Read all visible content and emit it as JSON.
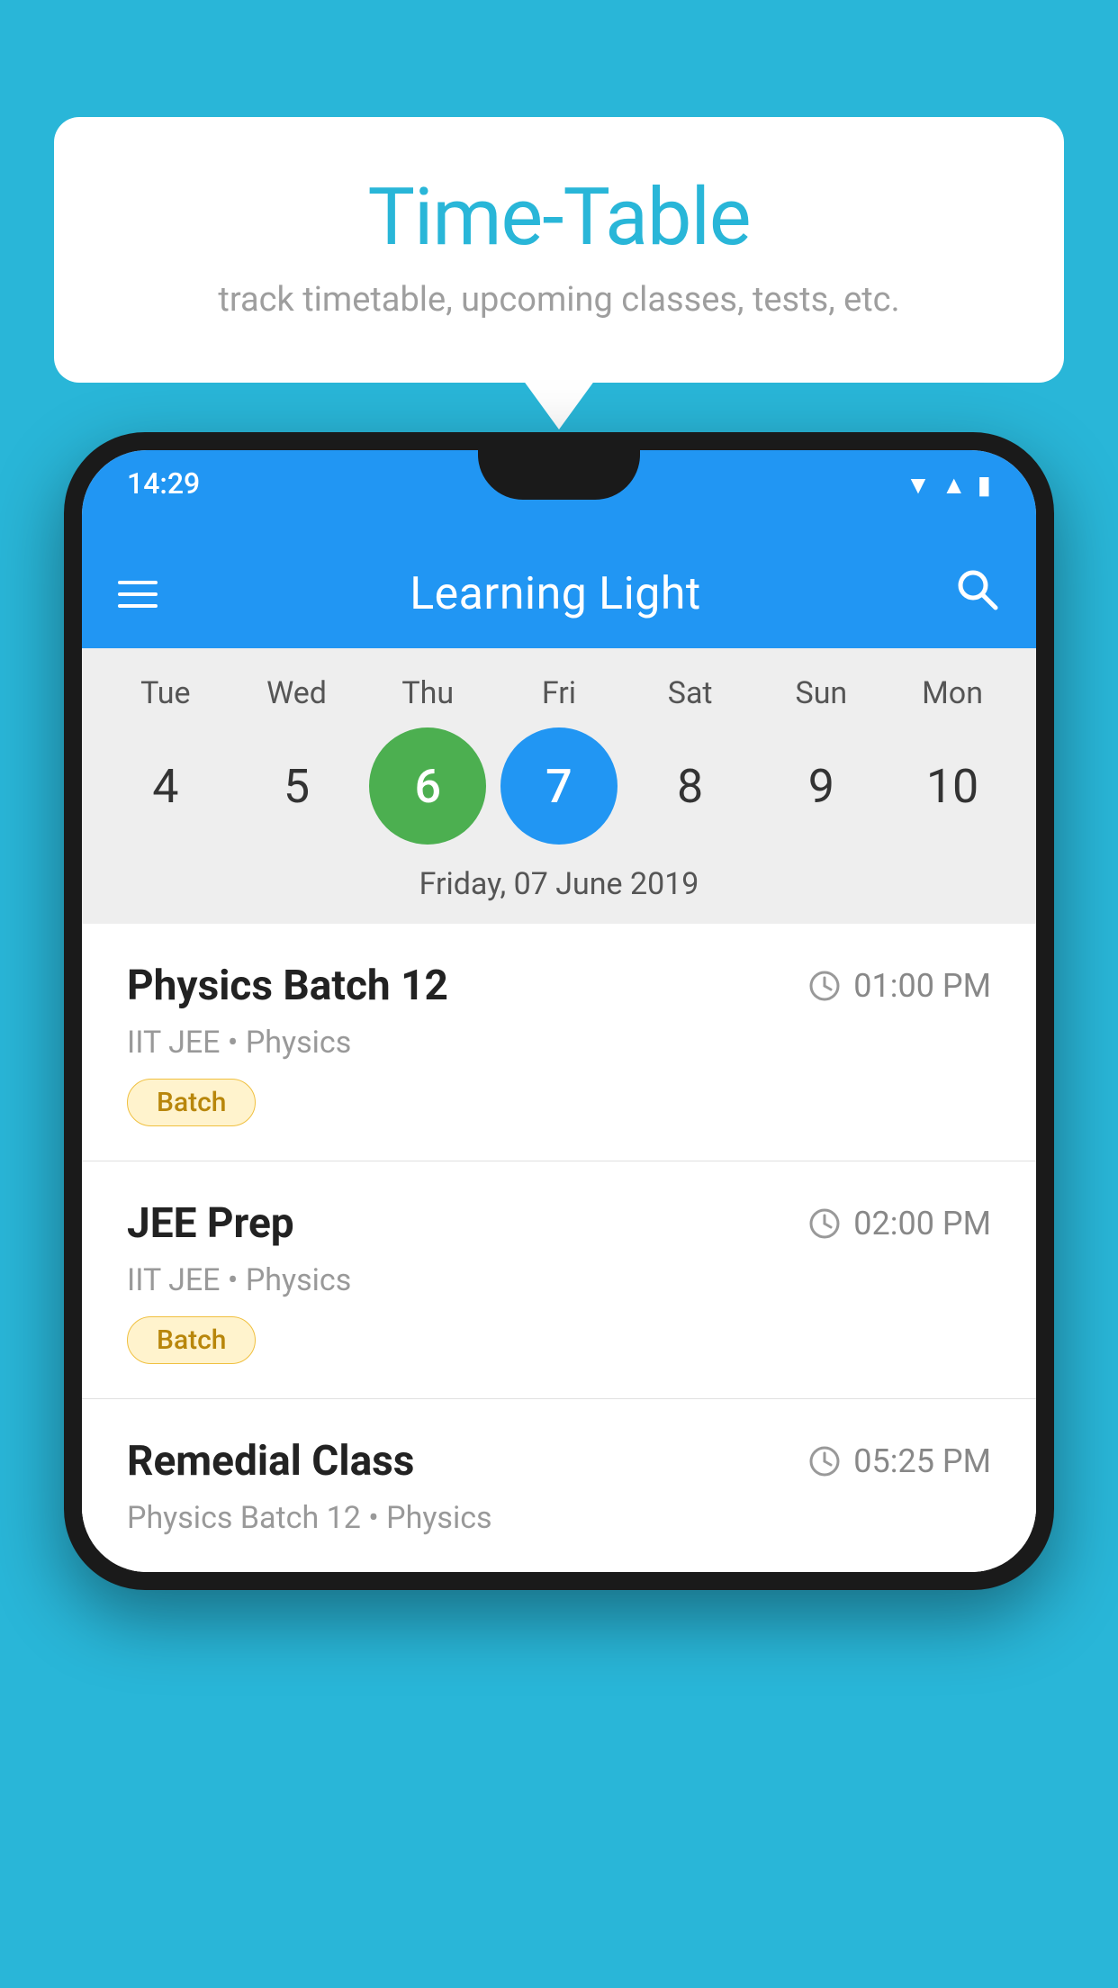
{
  "background_color": "#29B6D8",
  "speech_bubble": {
    "title": "Time-Table",
    "subtitle": "track timetable, upcoming classes, tests, etc."
  },
  "phone": {
    "status_bar": {
      "time": "14:29"
    },
    "app_header": {
      "title": "Learning Light"
    },
    "calendar": {
      "days": [
        "Tue",
        "Wed",
        "Thu",
        "Fri",
        "Sat",
        "Sun",
        "Mon"
      ],
      "dates": [
        "4",
        "5",
        "6",
        "7",
        "8",
        "9",
        "10"
      ],
      "today_index": 2,
      "selected_index": 3,
      "selected_label": "Friday, 07 June 2019"
    },
    "schedule_items": [
      {
        "title": "Physics Batch 12",
        "time": "01:00 PM",
        "subtitle": "IIT JEE • Physics",
        "badge": "Batch"
      },
      {
        "title": "JEE Prep",
        "time": "02:00 PM",
        "subtitle": "IIT JEE • Physics",
        "badge": "Batch"
      },
      {
        "title": "Remedial Class",
        "time": "05:25 PM",
        "subtitle": "Physics Batch 12 • Physics",
        "badge": null
      }
    ]
  }
}
